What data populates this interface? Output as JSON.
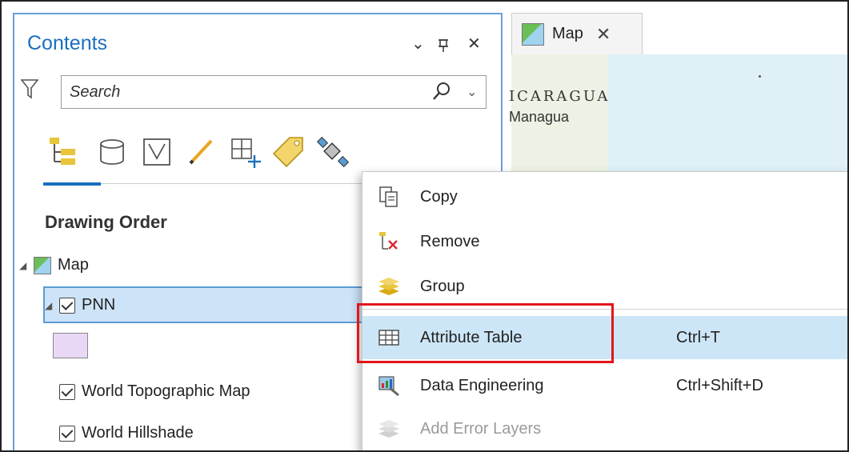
{
  "contents_pane": {
    "title": "Contents",
    "controls": {
      "dropdown": "⌄",
      "pin": "ꟷ",
      "close": "✕"
    },
    "search": {
      "placeholder": "Search"
    },
    "section_heading": "Drawing Order",
    "tree": [
      {
        "label": "Map",
        "type": "map",
        "expanded": true
      },
      {
        "label": "PNN",
        "type": "layer",
        "checked": true,
        "expanded": true,
        "selected": true,
        "symbol_color": "#e8d8f5"
      },
      {
        "label": "World Topographic Map",
        "type": "basemap",
        "checked": true
      },
      {
        "label": "World Hillshade",
        "type": "basemap",
        "checked": true
      }
    ],
    "toolbar_icons": [
      "list-by-drawing-order-icon",
      "list-by-data-source-icon",
      "list-by-selection-icon",
      "list-by-editing-icon",
      "list-by-snapping-icon",
      "list-by-labeling-icon",
      "list-by-perspective-imagery-icon"
    ]
  },
  "map_view": {
    "tab_label": "Map",
    "close_glyph": "✕",
    "labels": [
      "ICARAGUA",
      "Managua"
    ]
  },
  "context_menu": {
    "items": [
      {
        "label": "Copy",
        "shortcut": "",
        "icon": "copy-icon",
        "state": "normal"
      },
      {
        "label": "Remove",
        "shortcut": "",
        "icon": "remove-layer-icon",
        "state": "normal"
      },
      {
        "label": "Group",
        "shortcut": "",
        "icon": "group-layers-icon",
        "state": "normal"
      },
      {
        "label": "Attribute Table",
        "shortcut": "Ctrl+T",
        "icon": "attribute-table-icon",
        "state": "hover"
      },
      {
        "label": "Data Engineering",
        "shortcut": "Ctrl+Shift+D",
        "icon": "data-engineering-icon",
        "state": "normal"
      },
      {
        "label": "Add Error Layers",
        "shortcut": "",
        "icon": "add-error-layers-icon",
        "state": "disabled"
      }
    ]
  },
  "colors": {
    "accent": "#1a6fbf",
    "highlight_box": "#e0161b",
    "hover": "#cde6f7",
    "selection": "#cde3f7"
  }
}
